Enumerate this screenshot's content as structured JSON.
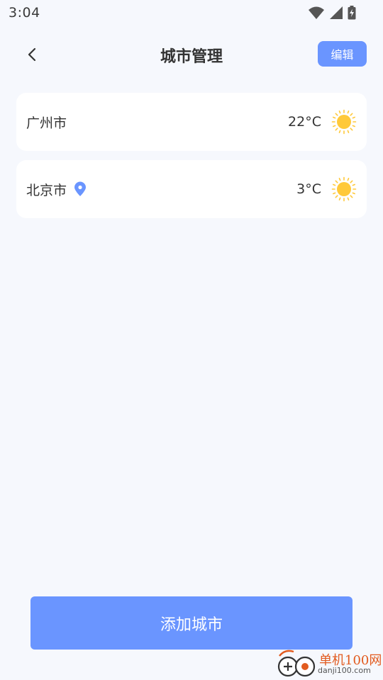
{
  "status_bar": {
    "time": "3:04",
    "icons": [
      "wifi-icon",
      "cell-signal-icon",
      "battery-charging-icon"
    ]
  },
  "header": {
    "title": "城市管理",
    "back_icon": "chevron-left-icon",
    "edit_label": "编辑"
  },
  "cities": [
    {
      "name": "广州市",
      "temp": "22°C",
      "weather_icon": "sun-icon",
      "location": false
    },
    {
      "name": "北京市",
      "temp": "3°C",
      "weather_icon": "sun-icon",
      "location": true,
      "location_icon": "location-pin-icon"
    }
  ],
  "footer": {
    "add_label": "添加城市"
  },
  "watermark": {
    "cn": "单机100网",
    "en": "danji100.com"
  },
  "colors": {
    "accent": "#6a95ff",
    "background": "#f6f8fd",
    "sun": "#ffc93a",
    "watermark": "#e25b1f"
  }
}
